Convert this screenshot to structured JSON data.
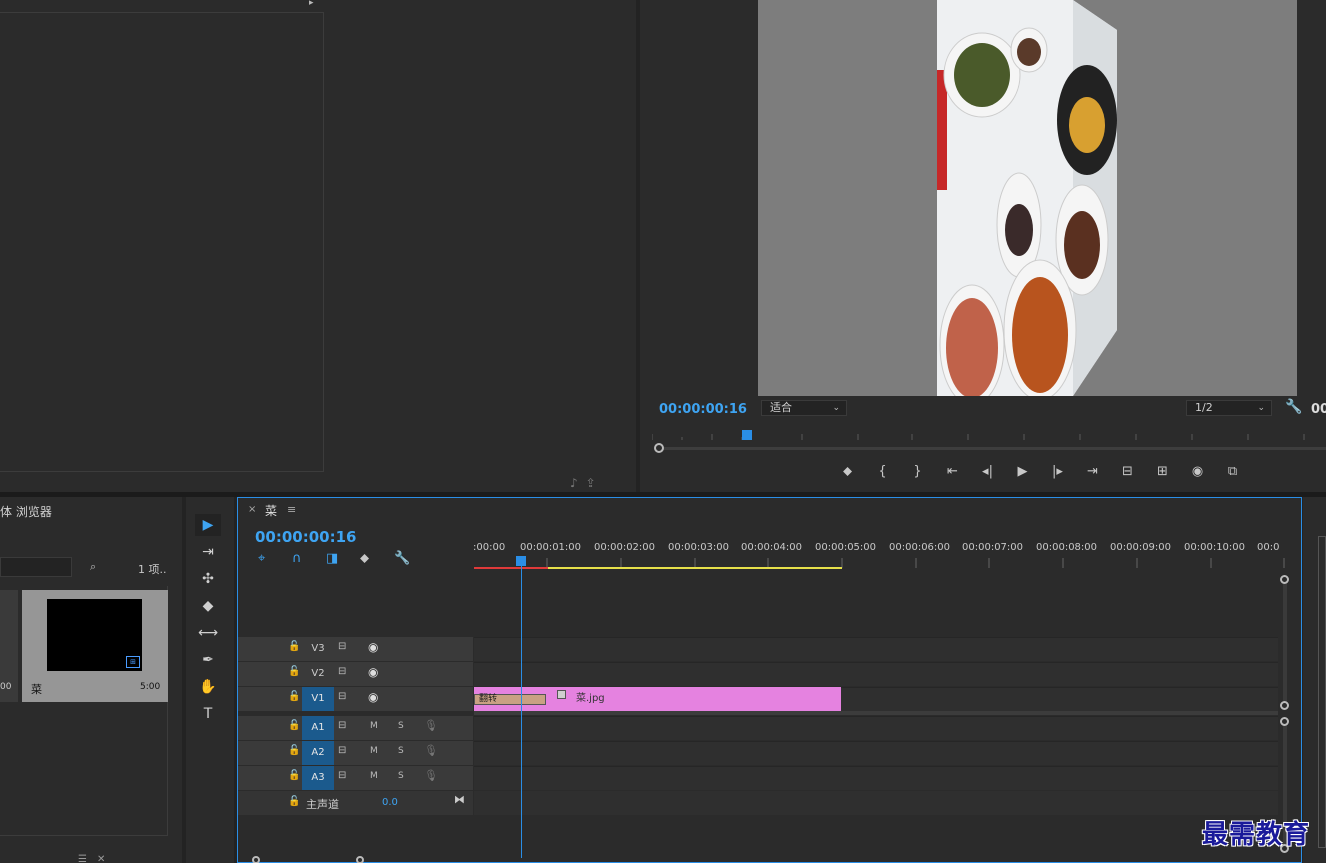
{
  "source": {
    "arrow": "▸",
    "bottom_icons": "♪⇪"
  },
  "program": {
    "timecode": "00:00:00:16",
    "fit_value": "适合",
    "resolution_value": "1/2",
    "timecode_right": "00",
    "transport": [
      "⬥",
      "{",
      "}",
      "⇤",
      "◂|",
      "▶",
      "|▸",
      "⇥",
      "⊟",
      "⊞",
      "◉",
      "⧉"
    ]
  },
  "media_browser": {
    "title": "体 浏览器",
    "count": "1 项..",
    "left_thumb_duration": "00",
    "thumb_name": "菜",
    "thumb_duration": "5:00",
    "bottom_icons": "☰✕"
  },
  "tools": [
    "▶",
    "⇥",
    "✣",
    "◆",
    "⟷",
    "✒",
    "✋",
    "T"
  ],
  "timeline": {
    "sequence_name": "菜",
    "close": "×",
    "menu": "≡",
    "timecode": "00:00:00:16",
    "tools": [
      "⌖",
      "∩",
      "◨",
      "⬥",
      "🔧"
    ],
    "ruler_labels": [
      ":00:00",
      "00:00:01:00",
      "00:00:02:00",
      "00:00:03:00",
      "00:00:04:00",
      "00:00:05:00",
      "00:00:06:00",
      "00:00:07:00",
      "00:00:08:00",
      "00:00:09:00",
      "00:00:10:00",
      "00:0"
    ],
    "video_tracks": [
      "V3",
      "V2",
      "V1"
    ],
    "audio_tracks": [
      "A1",
      "A2",
      "A3"
    ],
    "track_mute": "M",
    "track_solo": "S",
    "clip_transition": "翻转",
    "clip_name": "菜.jpg",
    "master_label": "主声道",
    "master_value": "0.0"
  },
  "watermark": "最需教育",
  "colors": {
    "accent": "#2a8ee6",
    "clip": "#e582e0",
    "timecode": "#3ea4f2",
    "work_area": "#e6e04a"
  }
}
